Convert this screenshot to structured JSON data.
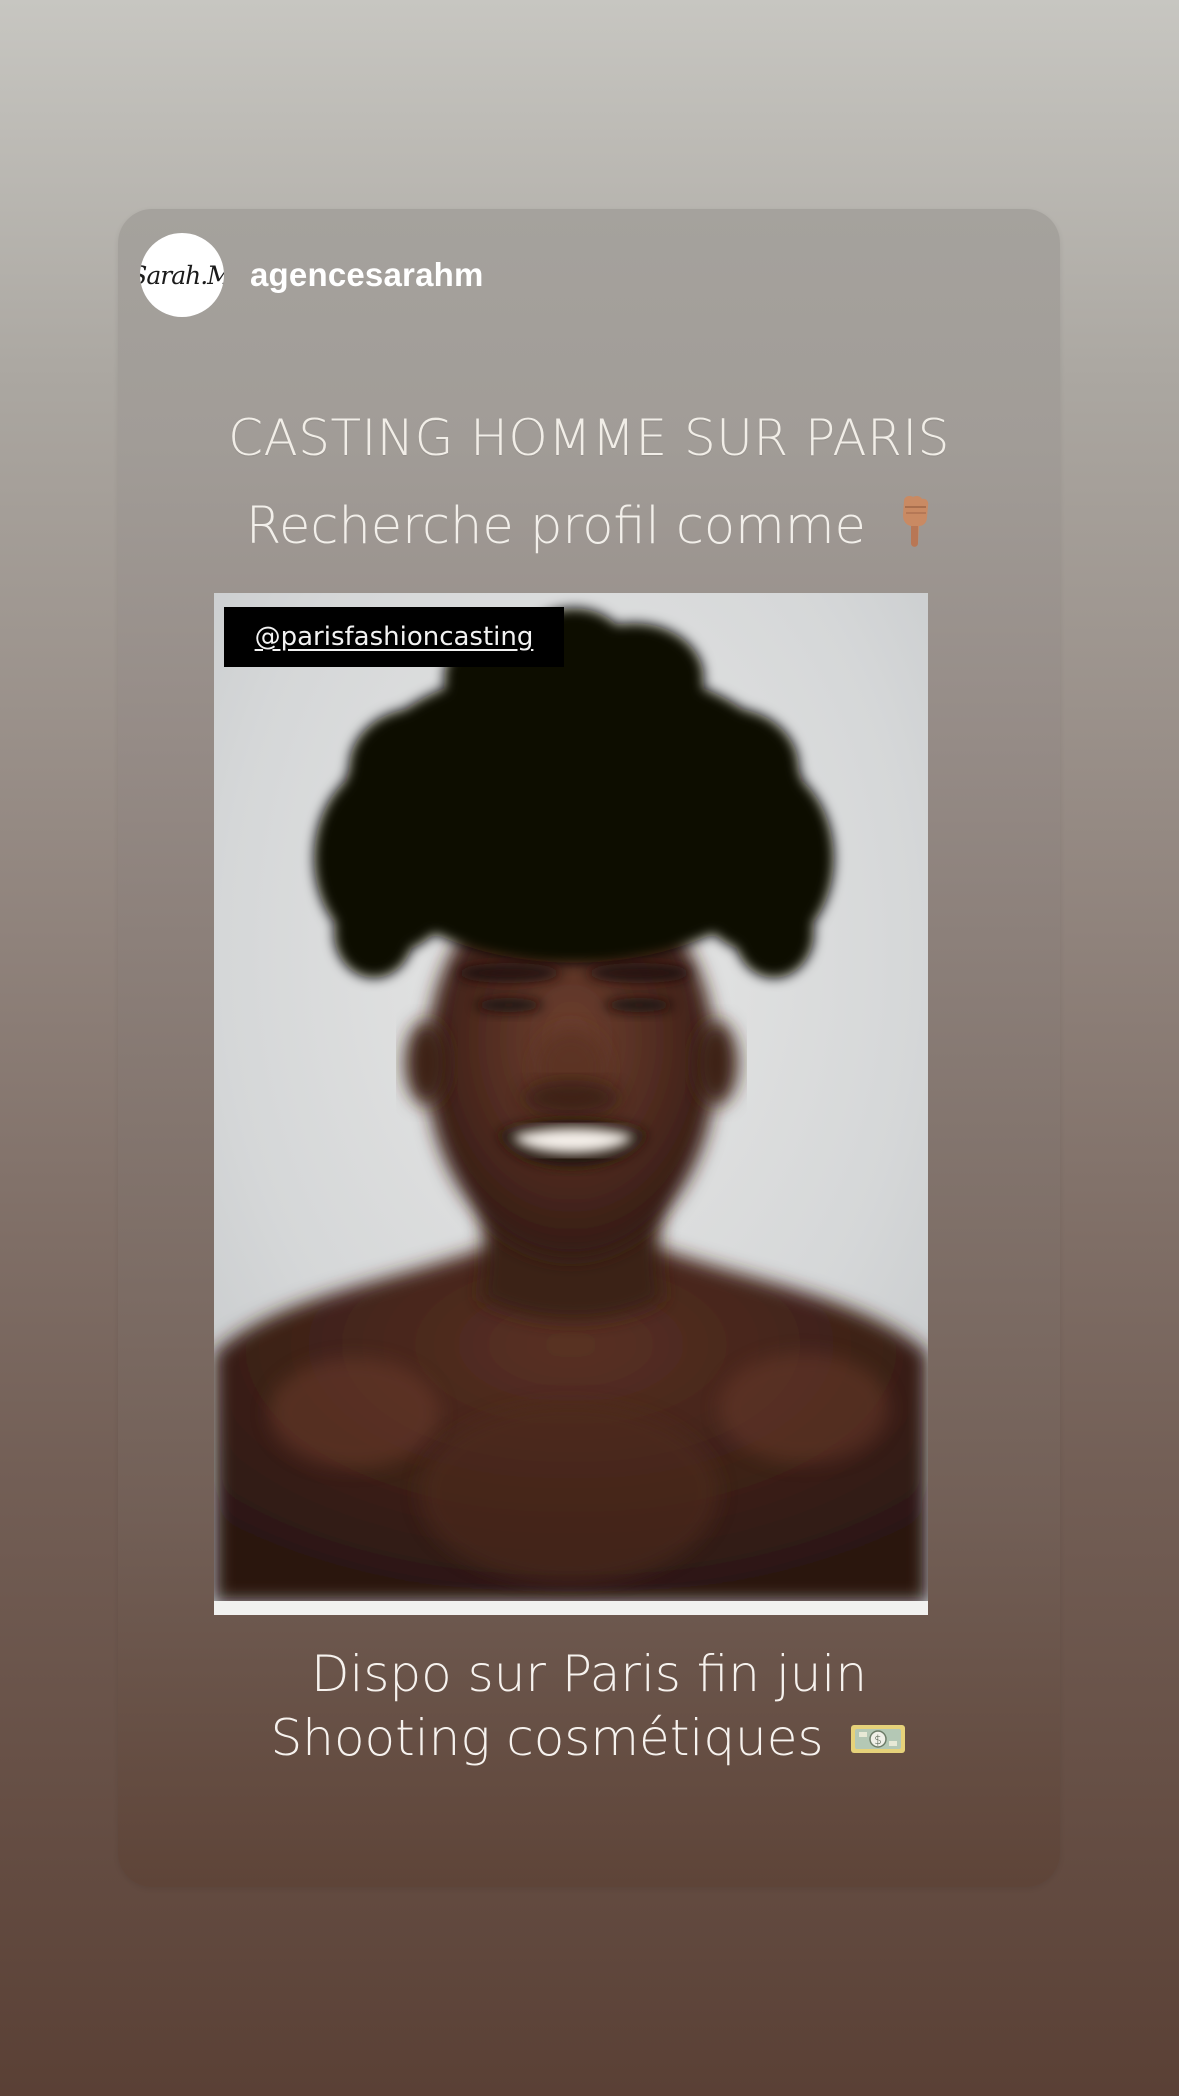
{
  "story": {
    "avatar_text": "Sarah.M",
    "username": "agencesarahm",
    "headline_1": "CASTING HOMME SUR PARIS",
    "headline_2": "Recherche profil comme",
    "headline_2_emoji": "backhand-index-pointing-down",
    "photo_tag": "@parisfashioncasting",
    "footer_1": "Dispo sur Paris fin juin",
    "footer_2": "Shooting cosmétiques",
    "footer_2_emoji": "money-with-wings"
  }
}
